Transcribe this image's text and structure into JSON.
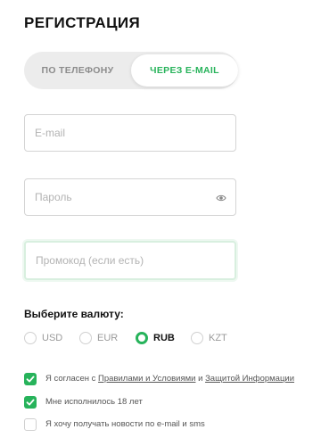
{
  "title": "РЕГИСТРАЦИЯ",
  "tabs": {
    "phone": "ПО ТЕЛЕФОНУ",
    "email": "ЧЕРЕЗ E-MAIL",
    "active": "email"
  },
  "fields": {
    "email_placeholder": "E-mail",
    "password_placeholder": "Пароль",
    "promo_placeholder": "Промокод (если есть)"
  },
  "currency": {
    "label": "Выберите валюту:",
    "options": [
      "USD",
      "EUR",
      "RUB",
      "KZT"
    ],
    "selected": "RUB"
  },
  "checkboxes": {
    "terms": {
      "checked": true,
      "prefix": "Я согласен с",
      "link1": "Правилами и Условиями",
      "middle": "и",
      "link2": "Защитой Информации"
    },
    "age": {
      "checked": true,
      "text": "Мне исполнилось 18 лет"
    },
    "news": {
      "checked": false,
      "text": "Я хочу получать новости по e-mail и sms"
    }
  },
  "colors": {
    "accent": "#27b35b",
    "field_border": "#d4d4d4",
    "tab_bg": "#ececec"
  },
  "icons": {
    "password_toggle": "eye-icon",
    "checkbox": "checkmark-icon"
  }
}
